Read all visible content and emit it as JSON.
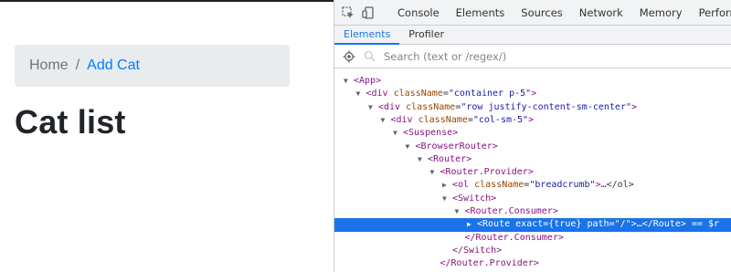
{
  "page": {
    "breadcrumb": {
      "home": "Home",
      "separator": "/",
      "current": "Add Cat"
    },
    "title": "Cat list"
  },
  "devtools": {
    "tabs": [
      "Console",
      "Elements",
      "Sources",
      "Network",
      "Memory",
      "Performance"
    ],
    "subtabs": [
      "Elements",
      "Profiler"
    ],
    "active_subtab": "Elements",
    "search_placeholder": "Search (text or /regex/)",
    "tree": [
      {
        "t": "open",
        "name": "App",
        "depth": 0
      },
      {
        "t": "open",
        "name": "div",
        "attr": "className",
        "value": "\"container p-5\"",
        "depth": 1
      },
      {
        "t": "open",
        "name": "div",
        "attr": "className",
        "value": "\"row justify-content-sm-center\"",
        "depth": 2
      },
      {
        "t": "open",
        "name": "div",
        "attr": "className",
        "value": "\"col-sm-5\"",
        "depth": 3
      },
      {
        "t": "open",
        "name": "Suspense",
        "depth": 4
      },
      {
        "t": "open",
        "name": "BrowserRouter",
        "depth": 5
      },
      {
        "t": "open",
        "name": "Router",
        "depth": 6
      },
      {
        "t": "open",
        "name": "Router.Provider",
        "depth": 7
      },
      {
        "t": "collapsed",
        "name": "ol",
        "attr": "className",
        "value": "\"breadcrumb\"",
        "tail": "…</ol>",
        "depth": 8
      },
      {
        "t": "open",
        "name": "Switch",
        "depth": 8
      },
      {
        "t": "open",
        "name": "Router.Consumer",
        "depth": 9
      },
      {
        "t": "selected",
        "name": "Route",
        "attr": "exact",
        "value": "{true}",
        "attr2": "path",
        "value2": "\"/\"",
        "tail": "…</Route> == $r",
        "depth": 10
      },
      {
        "t": "close",
        "name": "Router.Consumer",
        "depth": 9
      },
      {
        "t": "close",
        "name": "Switch",
        "depth": 8
      },
      {
        "t": "close",
        "name": "Router.Provider",
        "depth": 7
      }
    ]
  },
  "colors": {
    "link": "#007bff",
    "selection": "#1a73e8",
    "tag": "#881280",
    "attr": "#994500",
    "value": "#1a1aa6"
  }
}
